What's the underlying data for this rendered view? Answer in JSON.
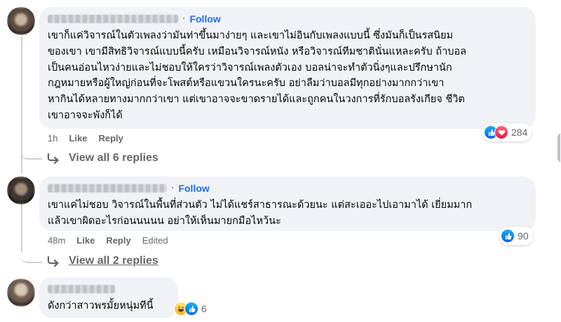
{
  "comments": [
    {
      "follow_label": "Follow",
      "text": "เขาก็แค่วิจารณ์ในตัวเพลงว่ามันท่าขึ้นมาง่ายๆ และเขาไม่อินกับเพลงแบบนี้ ซึ่งมันก็เป็นรสนิยม\nของเขา เขามีสิทธิวิจารณ์แบบนี้ครับ เหมือนวิจารณ์หนัง หรือวิจารณ์ทีมชาตินั่นแหละครับ ถ้าบอล\nเป็นคนอ่อนไหวง่ายและไม่ชอบให้ใครว่าวิจารณ์เพลงตัวเอง บอลน่าจะทำตัวนิ่งๆและปรึกษานัก\nกฎหมายหรือผู้ใหญ่ก่อนที่จะโพสต์หรือแขวนใครนะครับ อย่าลืมว่าบอลมีทุกอย่างมากกว่าเขา\nหากินได้หลายทางมากกว่าเขา แต่เขาอาจจะขาดรายได้และถูกคนในวงการที่รักบอลรังเกียจ ชีวิต\nเขาอาจจะพังก็ได้",
      "time": "1h",
      "like_label": "Like",
      "reply_label": "Reply",
      "reaction_count": "284",
      "replies_label": "View all 6 replies"
    },
    {
      "follow_label": "Follow",
      "text": "เขาแค่ไม่ชอบ วิจารณ์ในพื้นที่ส่วนตัว ไม่ได้แชร์สาธารณะด้วยนะ แต่สะเออะไปเอามาได้ เยี่ยมมาก\nแล้วเขาผิดอะไรก่อนนนนน อย่าให้เห็นมายกมือไหว้นะ",
      "time": "48m",
      "like_label": "Like",
      "reply_label": "Reply",
      "edited_label": "Edited",
      "reaction_count": "90",
      "replies_label": "View all 2 replies"
    },
    {
      "text": "ดังกว่าสาวพรมั้ยหนุ่มทีนี้",
      "reaction_count": "6"
    }
  ],
  "icons": {
    "reply": "reply-arrow-icon",
    "like": "like-reaction-icon",
    "love": "love-reaction-icon",
    "haha": "haha-reaction-icon"
  },
  "colors": {
    "bubble": "#f0f2f5",
    "follow": "#216fdb",
    "meta": "#65676b"
  }
}
